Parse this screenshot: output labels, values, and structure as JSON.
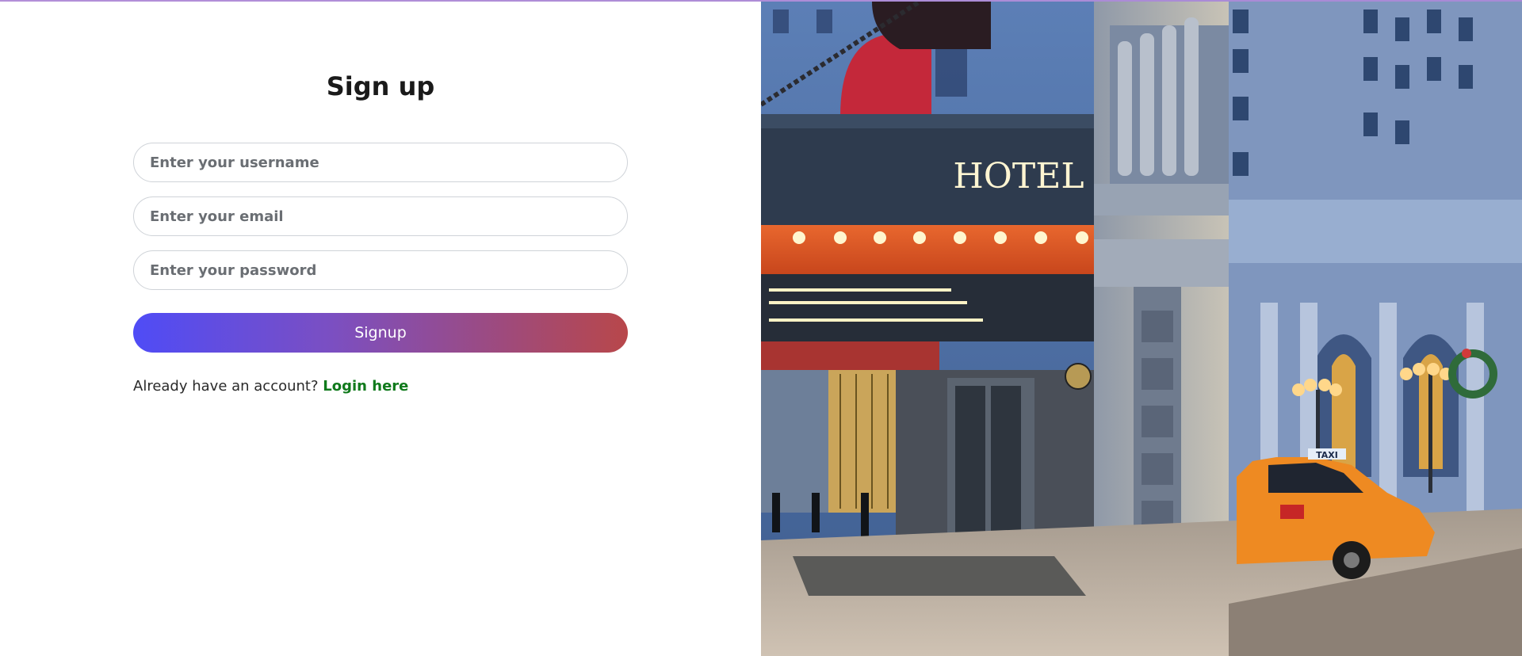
{
  "form": {
    "title": "Sign up",
    "username_placeholder": "Enter your username",
    "email_placeholder": "Enter your email",
    "password_placeholder": "Enter your password",
    "signup_label": "Signup",
    "login_prompt": "Already have an account?",
    "login_link": "Login here"
  },
  "hero": {
    "sign_text": "HOTEL",
    "taxi_text": "TAXI"
  },
  "colors": {
    "button_start": "#4f4cf6",
    "button_end": "#b8474a",
    "link": "#107a1c"
  }
}
